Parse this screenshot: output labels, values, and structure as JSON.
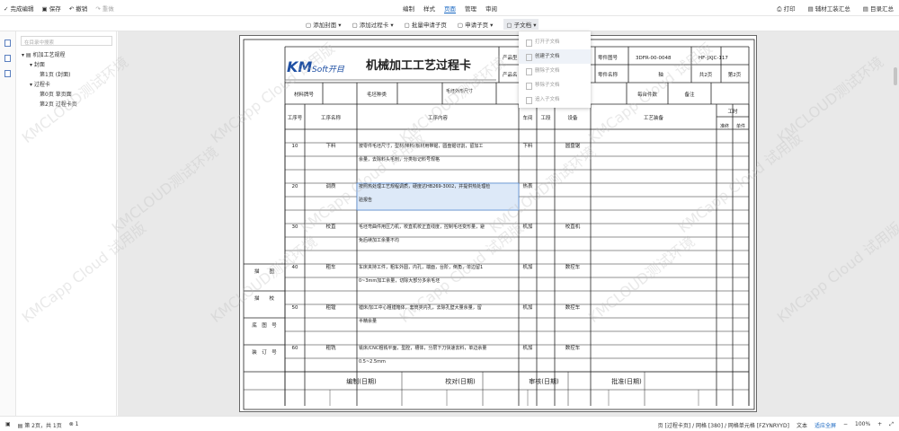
{
  "topbar": {
    "done": "完成编辑",
    "save": "保存",
    "undo": "撤销",
    "redo": "重做",
    "tabs": [
      "编制",
      "样式",
      "页面",
      "管理",
      "审阅"
    ],
    "right": [
      "打印",
      "辅材工装汇总",
      "目录汇总"
    ]
  },
  "toolbar": [
    "添加封面",
    "添加过程卡",
    "批量申请子页",
    "申请子页",
    "子文档"
  ],
  "sidebar": {
    "search_placeholder": "在目录中搜索",
    "tree": [
      "机加工艺规程",
      "封面",
      "第1页 (封面)",
      "过程卡",
      "第0页 草页面",
      "第2页 过程卡页"
    ]
  },
  "dropdown": [
    "打开子文档",
    "创建子文档",
    "删除子文档",
    "移除子文档",
    "追入子文档"
  ],
  "status": {
    "page": "第 2页，共 1页",
    "count": "1",
    "info": "页 [过程卡页] / 网格 [380] / 网格单元格 [FZYNRYYD]",
    "text": "文本",
    "fit": "适应全屏",
    "zoom": "100%"
  },
  "watermark": "KMCLOUD测试环境",
  "watermark2": "KMCapp Cloud 试用版",
  "card": {
    "logo_km": "KM",
    "logo_soft": "Soft开目",
    "title": "机械加工工艺过程卡",
    "product_no_lbl": "产品型",
    "product_name_lbl": "产品名",
    "part_no_lbl": "零件图号",
    "part_no": "3DFR-00-0048",
    "part_code": "HF-JXJC-117",
    "part_name_lbl": "零件名称",
    "part_name": "轴",
    "total": "共2页",
    "pageno": "第2页",
    "mat_code": "材料牌号",
    "blank_type": "毛坯种类",
    "blank_size": "毛坯外形尺寸",
    "per_blank": "每台件数",
    "note": "备注",
    "h_seq": "工序号",
    "h_name": "工序名称",
    "h_content": "工序内容",
    "h_shop": "车间",
    "h_sect": "工段",
    "h_equip": "设备",
    "h_tool": "工艺装备",
    "h_time": "工时",
    "h_prep": "准终",
    "h_unit": "单件",
    "rows": [
      {
        "seq": "10",
        "name": "下料",
        "c1": "按零件毛坯尺寸，型材/棒料/板材用带锯，圆盘锯切割，留加工",
        "c2": "余量，去除料头毛刺，分类标记料号规格",
        "shop": "下料",
        "equip": "圆盘锯"
      },
      {
        "seq": "20",
        "name": "调质",
        "c1": "按照热处理工艺规程调质，硬度达HB269-3002，并提供热处理检",
        "c2": "验报告",
        "shop": "热表",
        "equip": ""
      },
      {
        "seq": "30",
        "name": "校直",
        "c1": "毛坯弯曲件用压力机，校直机校正直线度，控制毛坯变形量，避",
        "c2": "免后续加工余量不均",
        "shop": "机加",
        "equip": "校直机"
      },
      {
        "seq": "40",
        "name": "粗车",
        "c1": "车床夹持工件，粗车外圆，内孔，端面，台阶，倒角，单边留1",
        "c2": "0~3mm加工余量，切除大部分多余毛坯",
        "shop": "机加",
        "equip": "数控车"
      },
      {
        "seq": "50",
        "name": "粗镗",
        "c1": "镗床/加工中心粗镗箱体，套筒类内孔，去除孔壁大量余量，留",
        "c2": "半精余量",
        "shop": "机加",
        "equip": "数控车"
      },
      {
        "seq": "60",
        "name": "粗铣",
        "c1": "铣床/CNC粗铣平面，型腔，槽体，分层下刀快速去料，单边余量",
        "c2": "0.5~2.5mm",
        "shop": "机加",
        "equip": "数控车"
      }
    ],
    "left_labels": [
      "描　　图",
      "描　　校",
      "底　图　号",
      "装　订　号"
    ],
    "footer": [
      "编制(日期)",
      "校对(日期)",
      "审核(日期)",
      "批准(日期)"
    ]
  }
}
